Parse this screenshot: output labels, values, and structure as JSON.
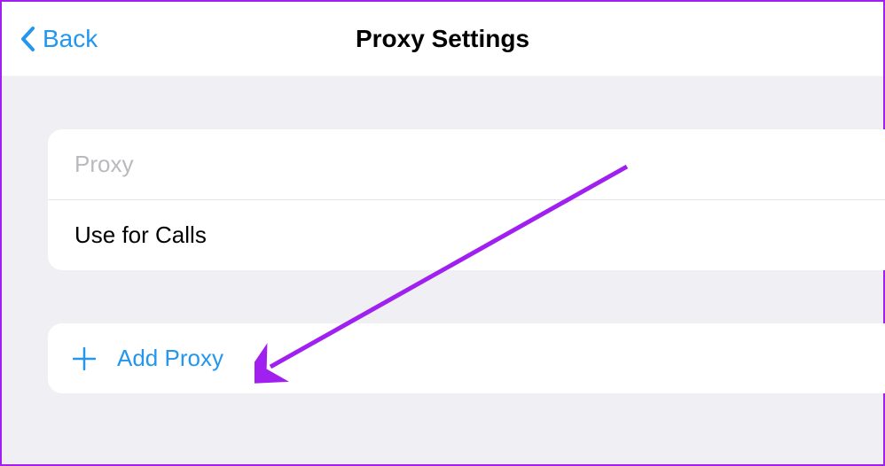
{
  "header": {
    "back_label": "Back",
    "title": "Proxy Settings"
  },
  "group1": {
    "proxy_label": "Proxy",
    "use_for_calls_label": "Use for Calls"
  },
  "group2": {
    "add_proxy_label": "Add Proxy"
  }
}
